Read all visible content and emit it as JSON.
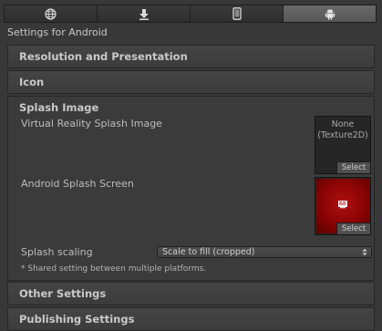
{
  "tabs": [
    {
      "icon": "globe-icon",
      "active": false
    },
    {
      "icon": "download-icon",
      "active": false
    },
    {
      "icon": "tablet-icon",
      "active": false
    },
    {
      "icon": "android-icon",
      "active": true
    }
  ],
  "title": "Settings for Android",
  "sections": {
    "resolution": "Resolution and Presentation",
    "icon": "Icon",
    "splash": "Splash Image",
    "other": "Other Settings",
    "publishing": "Publishing Settings"
  },
  "splash": {
    "vr_label": "Virtual Reality Splash Image",
    "vr_value_line1": "None",
    "vr_value_line2": "(Texture2D)",
    "select_label": "Select",
    "android_label": "Android Splash Screen",
    "scaling_label": "Splash scaling",
    "scaling_value": "Scale to fill (cropped)",
    "note": "* Shared setting between multiple platforms."
  },
  "colors": {
    "background": "#383838",
    "splash_texture": "#9a0505"
  }
}
